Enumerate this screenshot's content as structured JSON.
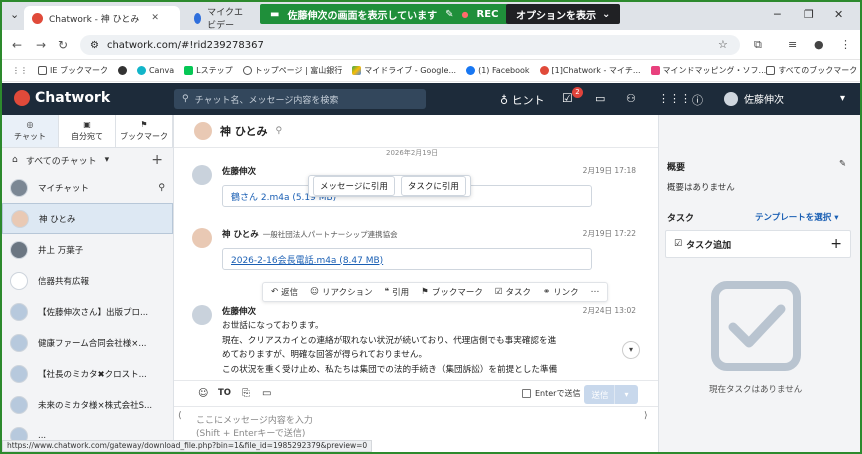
{
  "browser": {
    "tabs": [
      {
        "label": "Chatwork - 神 ひとみ",
        "active": true
      },
      {
        "label": "マイクエビデー",
        "active": false
      }
    ],
    "share_banner": "佐藤伸次の画面を表示しています",
    "rec_label": "REC",
    "options_label": "オプションを表示",
    "url": "chatwork.com/#!rid239278367",
    "status_url": "https://www.chatwork.com/gateway/download_file.php?bin=1&file_id=1985292379&preview=0"
  },
  "bookmarks": [
    "IE ブックマーク",
    "Canva",
    "Lステップ",
    "トップページ | 富山銀行",
    "マイドライブ - Google...",
    "(1) Facebook",
    "[1]Chatwork - マイチ...",
    "マインドマッピング・ソフ...",
    "すべてのブックマーク"
  ],
  "app": {
    "logo": "Chatwork",
    "search_placeholder": "チャット名、メッセージ内容を検索",
    "hint_label": "ヒント",
    "task_badge": "2",
    "user_name": "佐藤伸次"
  },
  "sidebar": {
    "tabs": [
      "チャット",
      "自分宛て",
      "ブックマーク"
    ],
    "all_chats": "すべてのチャット",
    "items": [
      {
        "label": "マイチャット",
        "color": "#7b8794",
        "pinned": true
      },
      {
        "label": "神 ひとみ",
        "color": "#e9c9b4",
        "selected": true
      },
      {
        "label": "井上 万葉子",
        "color": "#6b7682"
      },
      {
        "label": "信器共有広報",
        "color": "#ffffff"
      },
      {
        "label": "【佐藤伸次さん】出版プロ...",
        "color": "#b7c9dd"
      },
      {
        "label": "健康ファーム合同会社様×...",
        "color": "#b7c9dd"
      },
      {
        "label": "【社長のミカタ✖クロスト...",
        "color": "#b7c9dd"
      },
      {
        "label": "未来のミカタ様×株式会社S...",
        "color": "#b7c9dd"
      },
      {
        "label": "...",
        "color": "#b7c9dd"
      }
    ]
  },
  "room": {
    "title": "神 ひとみ",
    "date_chip": "2026年2月19日",
    "messages": [
      {
        "name": "佐藤伸次",
        "sub": "",
        "time": "2月19日 17:18",
        "file": "鶴さん 2.m4a (5.19 MB)"
      },
      {
        "name": "神 ひとみ",
        "sub": "一般社団法人パートナーシップ連携協会",
        "time": "2月19日 17:22",
        "file": "2026-2-16会長電話.m4a (8.47 MB)"
      },
      {
        "name": "佐藤伸次",
        "sub": "",
        "time": "2月24日 13:02",
        "file": ""
      }
    ],
    "popover": [
      "メッセージに引用",
      "タスクに引用"
    ],
    "actions": [
      "返信",
      "リアクション",
      "引用",
      "ブックマーク",
      "タスク",
      "リンク",
      "⋯"
    ],
    "body_lines": [
      "お世話になっております。",
      "現在、クリアスカイとの連絡が取れない状況が続いており、代理店側でも事実確認を進",
      "めておりますが、明確な回答が得られておりません。",
      "この状況を重く受け止め、私たちは集団での法的手続き（集団訴訟）を前提とした準備"
    ],
    "composer_to": "TO",
    "enter_label": "Enterで送信",
    "send_label": "送信",
    "composer_placeholder_1": "ここにメッセージ内容を入力",
    "composer_placeholder_2": "(Shift + Enterキーで送信)"
  },
  "right": {
    "overview_title": "概要",
    "overview_text": "概要はありません",
    "task_title": "タスク",
    "template_label": "テンプレートを選択",
    "task_add": "タスク追加",
    "empty_text": "現在タスクはありません"
  }
}
